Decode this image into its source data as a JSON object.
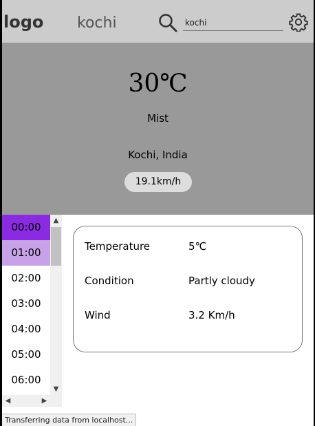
{
  "header": {
    "logo": "logo",
    "city": "kochi",
    "search": {
      "value": "kochi",
      "placeholder": ""
    },
    "icons": {
      "search": "search-icon",
      "settings": "gear-icon"
    }
  },
  "current": {
    "temperature": "30℃",
    "condition": "Mist",
    "location": "Kochi, India",
    "wind": "19.1km/h"
  },
  "hours": {
    "items": [
      "00:00",
      "01:00",
      "02:00",
      "03:00",
      "04:00",
      "05:00",
      "06:00"
    ],
    "active_index": 0,
    "selected_index": 1
  },
  "details": {
    "rows": [
      {
        "label": "Temperature",
        "value": "5℃"
      },
      {
        "label": "Condition",
        "value": "Partly cloudy"
      },
      {
        "label": "Wind",
        "value": "3.2 Km/h"
      }
    ]
  },
  "status": "Transferring data from localhost...",
  "colors": {
    "header_bg": "#cccccc",
    "hero_bg": "#999999",
    "hour_active": "#8a2be2",
    "hour_selected": "#c8a2e8",
    "pill_bg": "#dddddd"
  }
}
